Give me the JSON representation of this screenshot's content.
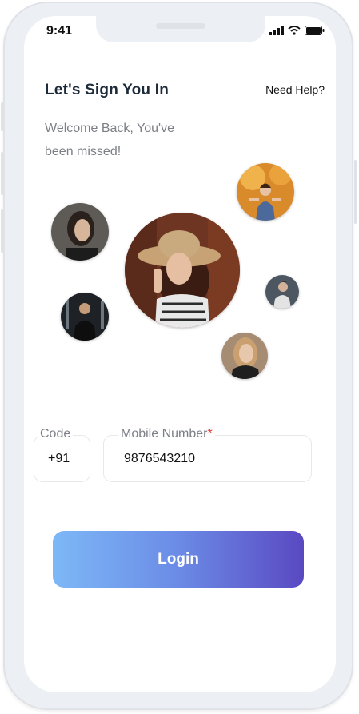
{
  "status_bar": {
    "time": "9:41"
  },
  "header": {
    "title": "Let's Sign You In",
    "help_link": "Need Help?"
  },
  "welcome": {
    "line1": "Welcome Back, You've",
    "line2": "been missed!"
  },
  "form": {
    "code": {
      "label": "Code",
      "value": "+91"
    },
    "mobile": {
      "label": "Mobile Number",
      "required_mark": "*",
      "value": "9876543210"
    }
  },
  "actions": {
    "login_label": "Login"
  },
  "colors": {
    "accent_start": "#7db8f7",
    "accent_end": "#5a49c2",
    "required": "#e53935"
  }
}
